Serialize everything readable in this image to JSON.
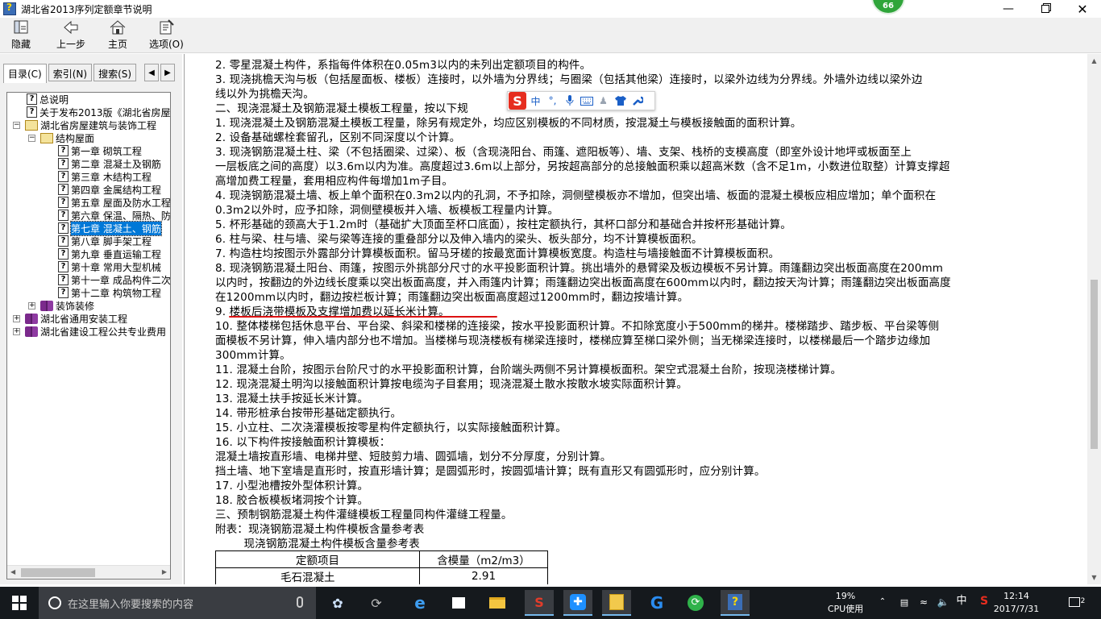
{
  "window": {
    "title": "湖北省2013序列定额章节说明",
    "badge": "66"
  },
  "toolbar": [
    {
      "label": "隐藏"
    },
    {
      "label": "上一步"
    },
    {
      "label": "主页"
    },
    {
      "label": "选项(O)"
    }
  ],
  "tabs": [
    {
      "label": "目录(C)"
    },
    {
      "label": "索引(N)"
    },
    {
      "label": "搜索(S)"
    }
  ],
  "tree": [
    {
      "label": "总说明",
      "icon": "question-page-icon"
    },
    {
      "label": "关于发布2013版《湖北省房屋",
      "icon": "question-page-icon"
    },
    {
      "label": "湖北省房屋建筑与装饰工程",
      "icon": "open-book-icon"
    },
    {
      "label": "结构屋面",
      "icon": "open-book-icon"
    },
    {
      "label": "第一章  砌筑工程",
      "icon": "question-page-icon"
    },
    {
      "label": "第二章  混凝土及钢筋",
      "icon": "question-page-icon"
    },
    {
      "label": "第三章  木结构工程",
      "icon": "question-page-icon"
    },
    {
      "label": "第四章  金属结构工程",
      "icon": "question-page-icon"
    },
    {
      "label": "第五章  屋面及防水工程",
      "icon": "question-page-icon"
    },
    {
      "label": "第六章  保温、隔热、防",
      "icon": "question-page-icon"
    },
    {
      "label": "第七章  混凝土、钢筋",
      "icon": "question-page-icon"
    },
    {
      "label": "第八章  脚手架工程",
      "icon": "question-page-icon"
    },
    {
      "label": "第九章  垂直运输工程",
      "icon": "question-page-icon"
    },
    {
      "label": "第十章  常用大型机械",
      "icon": "question-page-icon"
    },
    {
      "label": "第十一章  成品构件二次",
      "icon": "question-page-icon"
    },
    {
      "label": "第十二章  构筑物工程",
      "icon": "question-page-icon"
    },
    {
      "label": "装饰装修",
      "icon": "closed-book-icon"
    },
    {
      "label": "湖北省通用安装工程",
      "icon": "closed-book-icon"
    },
    {
      "label": "湖北省建设工程公共专业费用",
      "icon": "closed-book-icon"
    }
  ],
  "content": {
    "lines": [
      "2. 零星混凝土构件，系指每件体积在0.05m3以内的未列出定额项目的构件。",
      "3. 现浇挑檐天沟与板（包括屋面板、楼板）连接时，以外墙为分界线；与圈梁（包括其他梁）连接时，以梁外边线为分界线。外墙外边线以梁外边",
      "线以外为挑檐天沟。",
      "二、现浇混凝土及钢筋混凝土模板工程量，按以下规",
      "1. 现浇混凝土及钢筋混凝土模板工程量，除另有规定外，均应区别模板的不同材质，按混凝土与模板接触面的面积计算。",
      "2. 设备基础螺栓套留孔，区别不同深度以个计算。",
      "3. 现浇钢筋混凝土柱、梁（不包括圈梁、过梁）、板（含现浇阳台、雨篷、遮阳板等）、墙、支架、栈桥的支模高度（即室外设计地坪或板面至上",
      "一层板底之间的高度）以3.6m以内为准。高度超过3.6m以上部分，另按超高部分的总接触面积乘以超高米数（含不足1m，小数进位取整）计算支撑超",
      "高增加费工程量，套用相应构件每增加1m子目。",
      "4. 现浇钢筋混凝土墙、板上单个面积在0.3m2以内的孔洞，不予扣除，洞侧壁模板亦不增加，但突出墙、板面的混凝土模板应相应增加；单个面积在",
      "0.3m2以外时，应予扣除，洞侧壁模板并入墙、板模板工程量内计算。",
      "5. 杯形基础的颈高大于1.2m时（基础扩大顶面至杯口底面），按柱定额执行，其杯口部分和基础合并按杯形基础计算。",
      "6. 柱与梁、柱与墙、梁与梁等连接的重叠部分以及伸入墙内的梁头、板头部分，均不计算模板面积。",
      "7. 构造柱均按图示外露部分计算模板面积。留马牙槎的按最宽面计算模板宽度。构造柱与墙接触面不计算模板面积。",
      "8. 现浇钢筋混凝土阳台、雨篷，按图示外挑部分尺寸的水平投影面积计算。挑出墙外的悬臂梁及板边模板不另计算。雨篷翻边突出板面高度在200mm",
      "以内时，按翻边的外边线长度乘以突出板面高度，并入雨篷内计算；雨篷翻边突出板面高度在600mm以内时，翻边按天沟计算；雨篷翻边突出板面高度",
      "在1200mm以内时，翻边按栏板计算；雨篷翻边突出板面高度超过1200mm时，翻边按墙计算。",
      "9. 楼板后浇带模板及支撑增加费以延长米计算。",
      "10. 整体楼梯包括休息平台、平台梁、斜梁和楼梯的连接梁，按水平投影面积计算。不扣除宽度小于500mm的梯井。楼梯踏步、踏步板、平台梁等侧",
      "面模板不另计算，伸入墙内部分也不增加。当楼梯与现浇楼板有梯梁连接时，楼梯应算至梯口梁外侧；当无梯梁连接时，以楼梯最后一个踏步边缘加",
      "300mm计算。",
      "11. 混凝土台阶，按图示台阶尺寸的水平投影面积计算，台阶端头两侧不另计算模板面积。架空式混凝土台阶，按现浇楼梯计算。",
      "12. 现浇混凝土明沟以接触面积计算按电缆沟子目套用；现浇混凝土散水按散水坡实际面积计算。",
      "13. 混凝土扶手按延长米计算。",
      "14. 带形桩承台按带形基础定额执行。",
      "15. 小立柱、二次浇灌模板按零星构件定额执行，以实际接触面积计算。",
      "16. 以下构件按接触面积计算模板：",
      "混凝土墙按直形墙、电梯井壁、短肢剪力墙、圆弧墙，划分不分厚度，分别计算。",
      "挡土墙、地下室墙是直形时，按直形墙计算；是圆弧形时，按圆弧墙计算；既有直形又有圆弧形时，应分别计算。",
      "17. 小型池槽按外型体积计算。",
      "18. 胶合板模板堵洞按个计算。",
      "三、预制钢筋混凝土构件灌缝模板工程量同构件灌缝工程量。",
      "附表：现浇钢筋混凝土构件模板含量参考表",
      "        现浇钢筋混凝土构件模板含量参考表"
    ],
    "table": {
      "headers": [
        "定额项目",
        "含模量（m2/m3）"
      ],
      "rows": [
        [
          "毛石混凝土",
          "2.91"
        ]
      ]
    }
  },
  "ime": {
    "logo": "S",
    "mode": "中"
  },
  "taskbar": {
    "search_placeholder": "在这里输入你要搜索的内容",
    "cpu_percent": "19%",
    "cpu_label": "CPU使用",
    "ime_lang": "中",
    "time": "12:14",
    "date": "2017/7/31",
    "notifications": "2"
  },
  "colors": {
    "selection": "#0078d7",
    "taskbar": "#15191d",
    "underline": "#dd1111"
  }
}
